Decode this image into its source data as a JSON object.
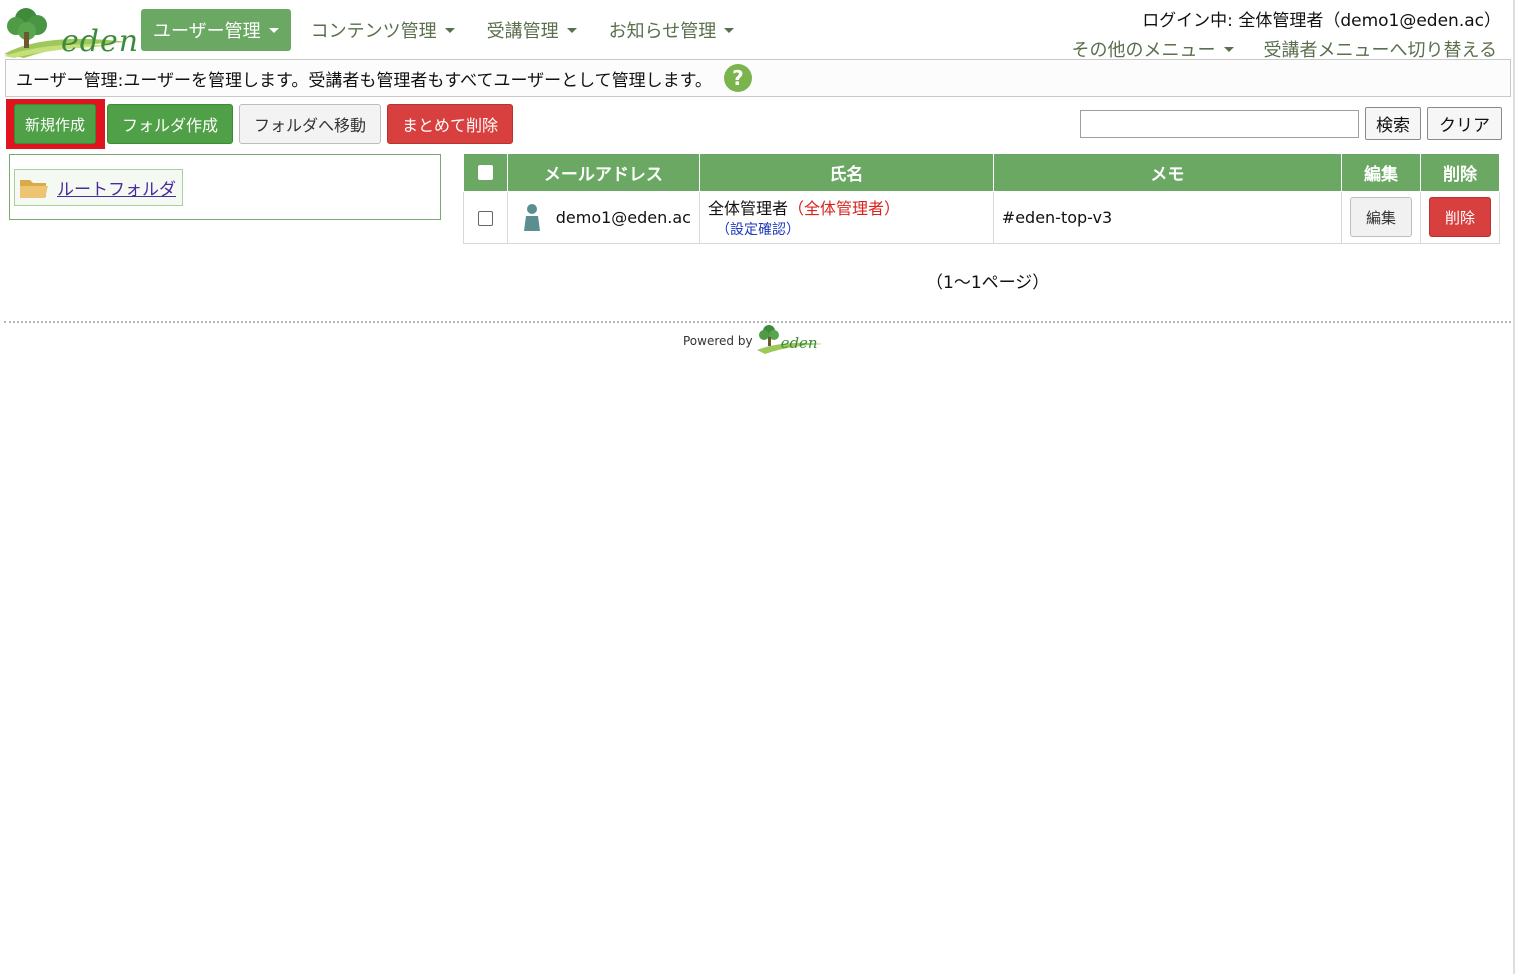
{
  "logo": {
    "text": "eden"
  },
  "nav": {
    "items": [
      {
        "label": "ユーザー管理",
        "active": true
      },
      {
        "label": "コンテンツ管理",
        "active": false
      },
      {
        "label": "受講管理",
        "active": false
      },
      {
        "label": "お知らせ管理",
        "active": false
      }
    ]
  },
  "header": {
    "login_info": "ログイン中: 全体管理者（demo1@eden.ac）",
    "other_menu": "その他のメニュー",
    "switch_menu": "受講者メニューへ切り替える"
  },
  "infobar": {
    "text": "ユーザー管理:ユーザーを管理します。受講者も管理者もすべてユーザーとして管理します。",
    "help_glyph": "?"
  },
  "toolbar": {
    "new_label": "新規作成",
    "new_folder_label": "フォルダ作成",
    "move_label": "フォルダへ移動",
    "bulk_delete_label": "まとめて削除",
    "search_value": "",
    "search_label": "検索",
    "clear_label": "クリア"
  },
  "tree": {
    "root_label": "ルートフォルダ"
  },
  "table": {
    "headers": {
      "email": "メールアドレス",
      "name": "氏名",
      "memo": "メモ",
      "edit": "編集",
      "delete": "削除"
    },
    "rows": [
      {
        "email": "demo1@eden.ac",
        "name": "全体管理者",
        "role": "（全体管理者）",
        "confirm": "（設定確認）",
        "memo": "#eden-top-v3",
        "edit_label": "編集",
        "delete_label": "削除"
      }
    ]
  },
  "pagination": {
    "text": "（1～1ページ）"
  },
  "footer": {
    "powered_by": "Powered by",
    "logo_text": "eden"
  },
  "colors": {
    "nav_active_bg": "#6aa863",
    "green_button": "#4fa046",
    "red_button": "#d7403e",
    "highlight": "#e0141e",
    "header_green": "#6aa863"
  }
}
